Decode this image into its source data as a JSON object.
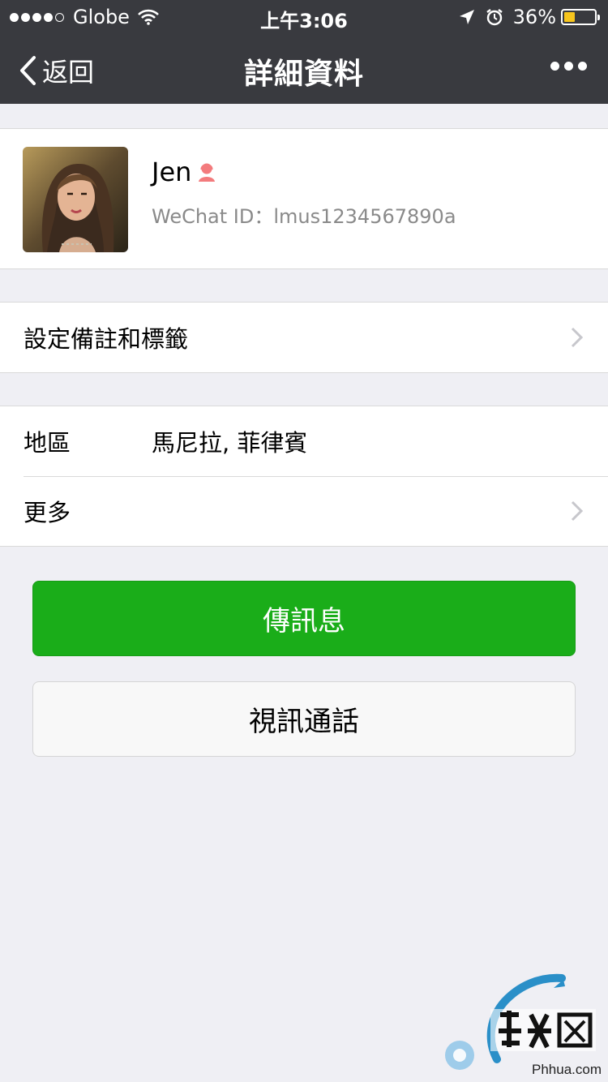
{
  "status_bar": {
    "carrier": "Globe",
    "time": "上午3:06",
    "battery_percent": "36%",
    "battery_level": 0.36,
    "battery_color": "#f7c51d",
    "icons": [
      "signal-dots-icon",
      "wifi-icon",
      "location-arrow-icon",
      "alarm-icon",
      "battery-icon"
    ]
  },
  "nav": {
    "back_label": "返回",
    "title": "詳細資料",
    "more_icon": "ellipsis-icon"
  },
  "profile": {
    "name": "Jen",
    "gender_icon": "female-icon",
    "wechat_id": "WeChat ID：lmus1234567890a"
  },
  "menu": {
    "set_remark": "設定備註和標籤",
    "region_label": "地區",
    "region_value": "馬尼拉, 菲律賓",
    "more": "更多"
  },
  "buttons": {
    "send_message": "傳訊息",
    "video_call": "視訊通話"
  },
  "watermark": {
    "text": "Phhua.com"
  },
  "colors": {
    "nav_bg": "#393a3f",
    "primary_green": "#1aad19",
    "page_bg": "#efeff4"
  }
}
